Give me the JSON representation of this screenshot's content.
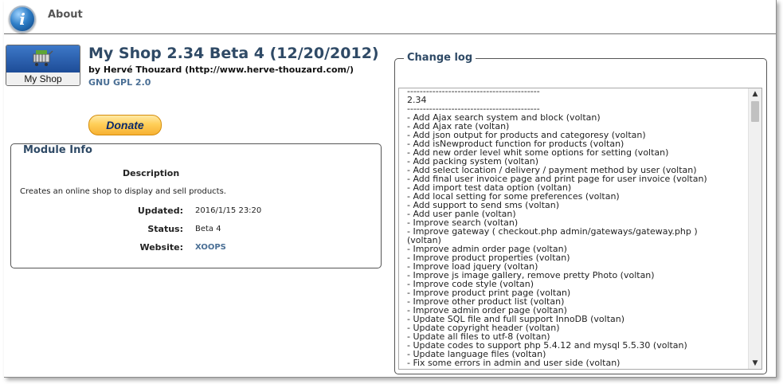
{
  "header": {
    "title": "About"
  },
  "module": {
    "logo_text": "My Shop",
    "title": "My Shop 2.34 Beta 4 (12/20/2012)",
    "author_line": "by Hervé Thouzard (http://www.herve-thouzard.com/)",
    "license": "GNU GPL 2.0",
    "donate_label": "Donate"
  },
  "module_info": {
    "legend": "Module Info",
    "description_heading": "Description",
    "description": "Creates an online shop to display and sell products.",
    "updated_label": "Updated:",
    "updated_value": "2016/1/15 23:20",
    "status_label": "Status:",
    "status_value": "Beta 4",
    "website_label": "Website:",
    "website_value": "XOOPS"
  },
  "changelog": {
    "legend": "Change log",
    "text": "------------------------------------------\n2.34\n------------------------------------------\n- Add Ajax search system and block (voltan)\n- Add Ajax rate (voltan)\n- Add json output for products and categoresy (voltan)\n- Add isNewproduct function for products (voltan)\n- Add new order level whit some options for setting (voltan)\n- Add packing system (voltan)\n- Add select location / delivery / payment method by user (voltan)\n- Add final user invoice page and print page for user invoice (voltan)\n- Add import test data option (voltan)\n- Add local setting for some preferences (voltan)\n- Add support to send sms (voltan)\n- Add user panle (voltan)\n- Improve search (voltan)\n- Improve gateway ( checkout.php admin/gateways/gateway.php )\n(voltan)\n- Improve admin order page (voltan)\n- Improve product properties (voltan)\n- Improve load jquery (voltan)\n- Improve js image gallery, remove pretty Photo (voltan)\n- Improve code style (voltan)\n- Improve product print page (voltan)\n- Improve other product list (voltan)\n- Improve admin order page (voltan)\n- Update SQL file and full support InnoDB (voltan)\n- Update copyright header (voltan)\n- Update all files to utf-8 (voltan)\n- Update codes to support php 5.4.12 and mysql 5.5.30 (voltan)\n- Update language files (voltan)\n- Fix some errors in admin and user side (voltan)"
  },
  "colors": {
    "heading": "#2f4a66",
    "link": "#4a6f95",
    "donate": "#ffcf59"
  }
}
